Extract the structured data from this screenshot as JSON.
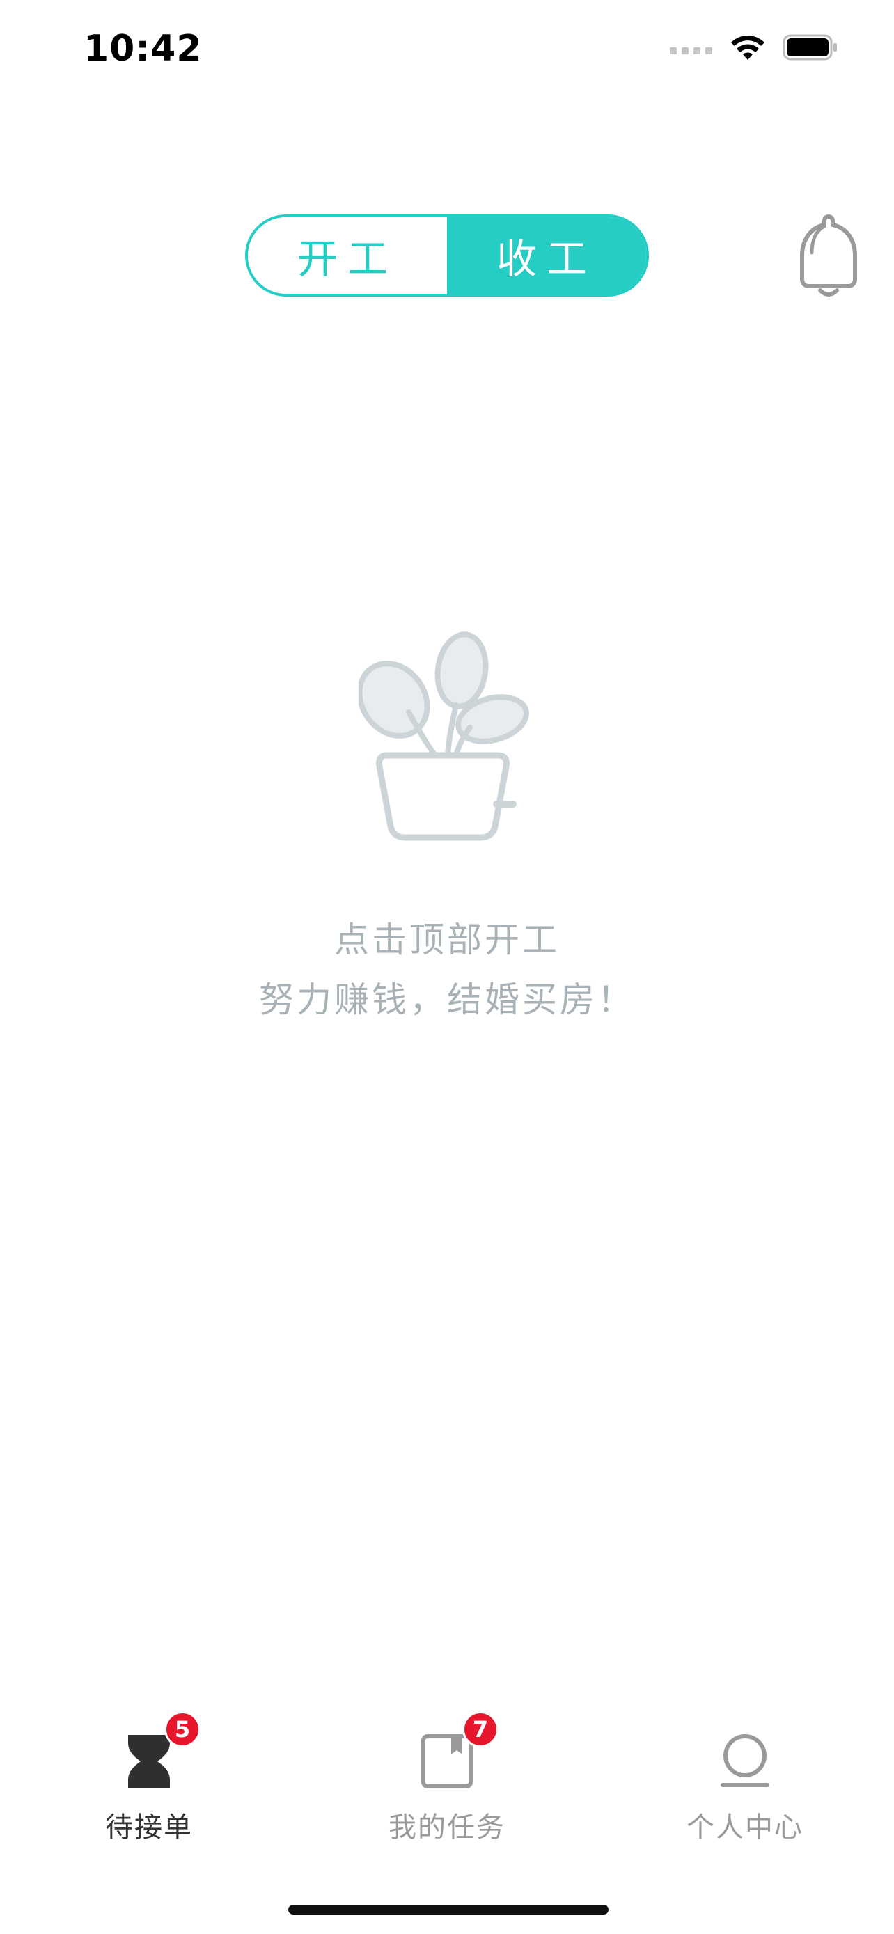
{
  "status_bar": {
    "time": "10:42"
  },
  "header": {
    "toggle": {
      "options": [
        {
          "label": "开工",
          "selected": false
        },
        {
          "label": "收工",
          "selected": true
        }
      ]
    },
    "bell_icon": "bell-icon"
  },
  "empty_state": {
    "illustration": "potted-plant-icon",
    "line1": "点击顶部开工",
    "line2": "努力赚钱，结婚买房！"
  },
  "tab_bar": {
    "tabs": [
      {
        "label": "待接单",
        "icon": "hourglass-icon",
        "badge": "5",
        "active": true
      },
      {
        "label": "我的任务",
        "icon": "task-book-icon",
        "badge": "7",
        "active": false
      },
      {
        "label": "个人中心",
        "icon": "person-icon",
        "badge": "",
        "active": false
      }
    ]
  },
  "colors": {
    "accent": "#25cdc5",
    "badge": "#e6172c",
    "muted_text": "#a8b1b6",
    "active_tab_text": "#333333",
    "inactive_tab_text": "#9a9a9a"
  }
}
